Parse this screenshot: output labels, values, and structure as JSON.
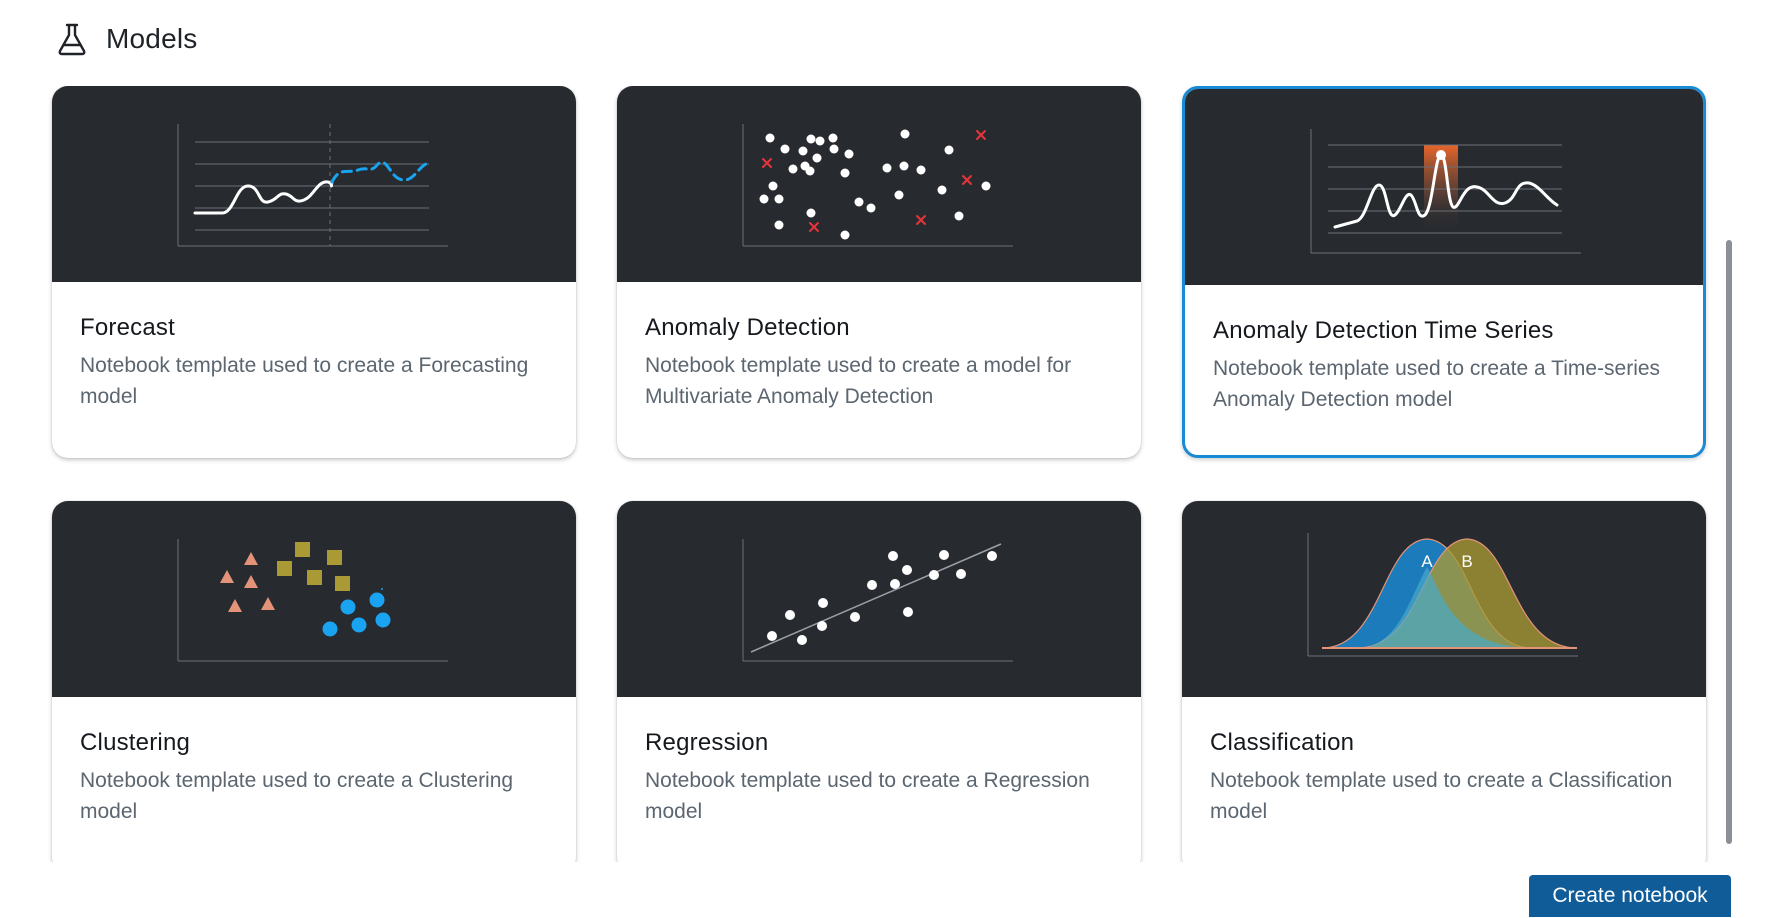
{
  "header": {
    "title": "Models",
    "icon": "flask-icon"
  },
  "cards": [
    {
      "title": "Forecast",
      "description": "Notebook template used to create a Forecasting model",
      "illustration": "forecast-chart"
    },
    {
      "title": "Anomaly Detection",
      "description": "Notebook template used to create a model for Multivariate Anomaly Detection",
      "illustration": "anomaly-scatter"
    },
    {
      "title": "Anomaly Detection Time Series",
      "description": "Notebook template used to create a Time-series Anomaly Detection model",
      "illustration": "anomaly-timeseries",
      "selected": true
    },
    {
      "title": "Clustering",
      "description": "Notebook template used to create a Clustering model",
      "illustration": "clusters"
    },
    {
      "title": "Regression",
      "description": "Notebook template used to create a Regression model",
      "illustration": "regression-scatter"
    },
    {
      "title": "Classification",
      "description": "Notebook template used to create a Classification model",
      "illustration": "classification-curves",
      "labels": [
        "A",
        "B"
      ]
    }
  ],
  "footer": {
    "create_label": "Create notebook"
  },
  "colors": {
    "accent": "#1a8ad4",
    "button": "#0f5c99",
    "thumb_bg": "#272b30",
    "anomaly": "#e8333a",
    "forecast": "#1aa3f0"
  }
}
